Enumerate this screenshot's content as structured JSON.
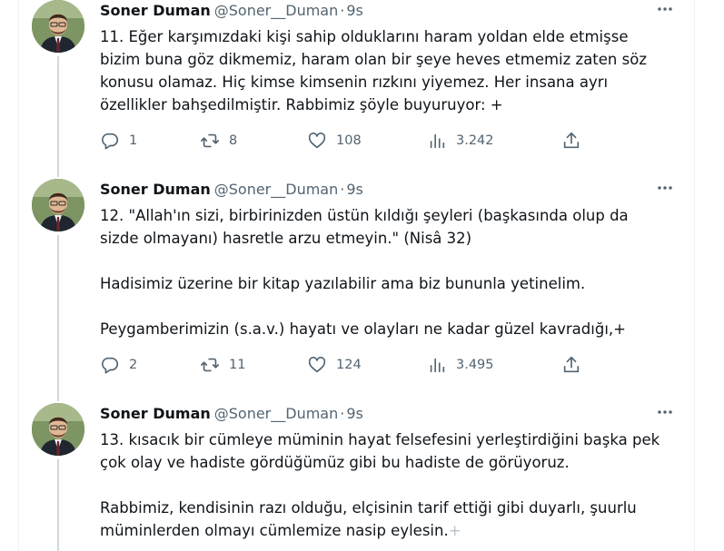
{
  "tweets": [
    {
      "author": {
        "name": "Soner Duman",
        "handle": "@Soner__Duman",
        "time": "9s"
      },
      "paragraphs": [
        [
          "11. Eğer karşımızdaki kişi sahip olduklarını haram yoldan elde etmişse",
          "bizim buna göz dikmemiz, haram olan bir şeye heves etmemiz zaten söz",
          "konusu olamaz. Hiç kimse kimsenin rızkını yiyemez. Her insana ayrı",
          "özellikler bahşedilmiştir. Rabbimiz şöyle buyuruyor: +"
        ]
      ],
      "stats": {
        "replies": "1",
        "retweets": "8",
        "likes": "108",
        "views": "3.242"
      }
    },
    {
      "author": {
        "name": "Soner Duman",
        "handle": "@Soner__Duman",
        "time": "9s"
      },
      "paragraphs": [
        [
          "12. \"Allah'ın sizi, birbirinizden üstün kıldığı şeyleri (başkasında olup da",
          "sizde olmayanı) hasretle arzu etmeyin.\" (Nisâ 32)"
        ],
        [
          "Hadisimiz üzerine bir kitap yazılabilir ama biz bununla yetinelim."
        ],
        [
          "Peygamberimizin (s.a.v.) hayatı ve olayları ne kadar güzel kavradığı,+"
        ]
      ],
      "stats": {
        "replies": "2",
        "retweets": "11",
        "likes": "124",
        "views": "3.495"
      }
    },
    {
      "author": {
        "name": "Soner Duman",
        "handle": "@Soner__Duman",
        "time": "9s"
      },
      "paragraphs": [
        [
          "13. kısacık bir cümleye müminin hayat felsefesini yerleştirdiğini başka pek",
          "çok olay ve hadiste gördüğümüz gibi bu hadiste de görüyoruz."
        ],
        [
          "Rabbimiz, kendisinin razı olduğu, elçisinin tarif ettiği gibi duyarlı, şuurlu",
          "müminlerden olmayı cümlemize nasip eylesin."
        ]
      ],
      "trailing_faded": "+",
      "stats": null
    }
  ],
  "icons": [
    "more-icon",
    "reply-icon",
    "retweet-icon",
    "like-icon",
    "views-icon",
    "share-icon"
  ],
  "colors": {
    "text": "#0f1419",
    "secondary": "#536471",
    "thread_line": "#cfd9de",
    "border": "#eff3f4"
  }
}
